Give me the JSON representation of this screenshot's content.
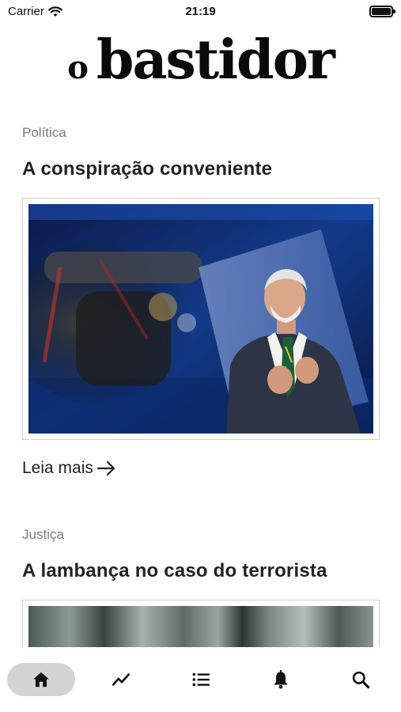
{
  "status_bar": {
    "carrier": "Carrier",
    "time": "21:19"
  },
  "logo": {
    "small": "o",
    "big": "bastidor"
  },
  "articles": [
    {
      "category": "Política",
      "headline": "A conspiração conveniente",
      "read_more": "Leia mais"
    },
    {
      "category": "Justiça",
      "headline": "A lambança no caso do terrorista"
    }
  ],
  "tabs": [
    {
      "icon": "home-icon",
      "active": true
    },
    {
      "icon": "trending-icon",
      "active": false
    },
    {
      "icon": "list-icon",
      "active": false
    },
    {
      "icon": "bell-icon",
      "active": false
    },
    {
      "icon": "search-icon",
      "active": false
    }
  ]
}
